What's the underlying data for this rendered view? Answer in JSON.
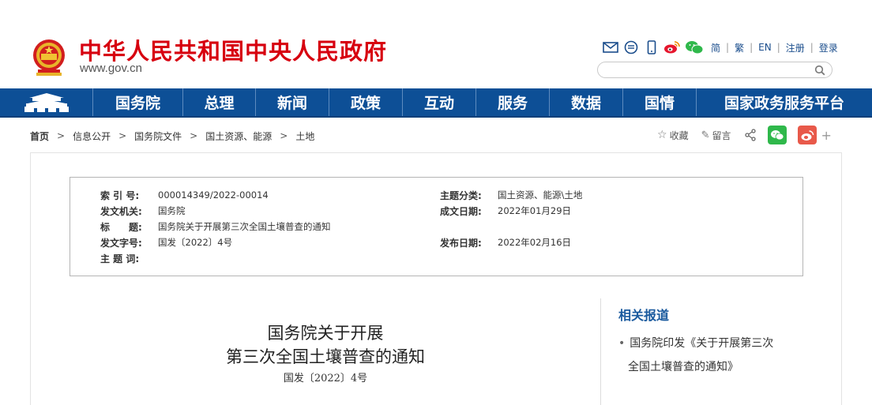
{
  "header": {
    "site_title": "中华人民共和国中央人民政府",
    "site_url": "www.gov.cn",
    "links": [
      "简",
      "繁",
      "EN",
      "注册",
      "登录"
    ],
    "search": {
      "value": "",
      "placeholder": ""
    },
    "icons": [
      "mail-icon",
      "chat-icon",
      "mobile-icon",
      "weibo-icon",
      "wechat-icon"
    ]
  },
  "nav": {
    "home_icon": "tiananmen-icon",
    "items": [
      "国务院",
      "总理",
      "新闻",
      "政策",
      "互动",
      "服务",
      "数据",
      "国情",
      "国家政务服务平台"
    ]
  },
  "breadcrumb": [
    "首页",
    "信息公开",
    "国务院文件",
    "国土资源、能源",
    "土地"
  ],
  "page_tools": {
    "favorite": "收藏",
    "comment": "留言"
  },
  "info": {
    "index_label": "索 引 号:",
    "index_value": "000014349/2022-00014",
    "category_label": "主题分类:",
    "category_value": "国土资源、能源\\土地",
    "issuer_label": "发文机关:",
    "issuer_value": "国务院",
    "created_label": "成文日期:",
    "created_value": "2022年01月29日",
    "title_label": "标　　题:",
    "title_value": "国务院关于开展第三次全国土壤普查的通知",
    "docno_label": "发文字号:",
    "docno_value": "国发〔2022〕4号",
    "published_label": "发布日期:",
    "published_value": "2022年02月16日",
    "keywords_label": "主 题 词:",
    "keywords_value": ""
  },
  "article": {
    "title_line1": "国务院关于开展",
    "title_line2": "第三次全国土壤普查的通知",
    "doc_number": "国发〔2022〕4号"
  },
  "related": {
    "title": "相关报道",
    "item_line1": "国务院印发《关于开展第三次",
    "item_line2": "全国土壤普查的通知》"
  },
  "colors": {
    "brand_red": "#d7000f",
    "nav_blue": "#0d4f96",
    "link_blue": "#1a5a9e",
    "wechat_green": "#2fb84b",
    "weibo_red": "#e8594a"
  }
}
